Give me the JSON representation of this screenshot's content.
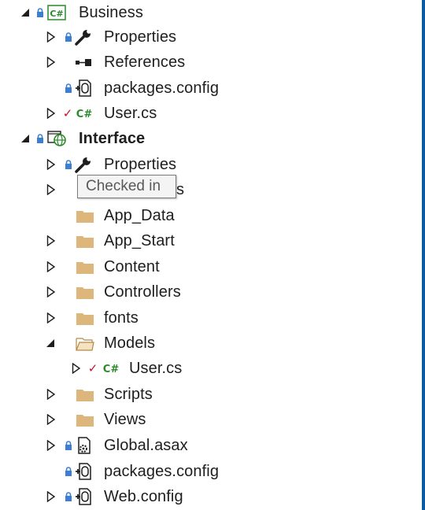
{
  "tree": {
    "business": {
      "label": "Business",
      "children": {
        "properties": "Properties",
        "references": "References",
        "packages_config": "packages.config",
        "user_cs": "User.cs"
      }
    },
    "interface": {
      "label": "Interface",
      "children": {
        "properties": "Properties",
        "references_partial": "s",
        "app_data": "App_Data",
        "app_start": "App_Start",
        "content": "Content",
        "controllers": "Controllers",
        "fonts": "fonts",
        "models": "Models",
        "models_user_cs": "User.cs",
        "scripts": "Scripts",
        "views": "Views",
        "global_asax": "Global.asax",
        "packages_config": "packages.config",
        "web_config": "Web.config"
      }
    }
  },
  "tooltip": "Checked in",
  "colors": {
    "lock": "#3a7fd0",
    "checkmark": "#c8102e",
    "csharp": "#2a8a2a",
    "folder": "#dcb67a",
    "selection_edge": "#0b5aa4"
  }
}
